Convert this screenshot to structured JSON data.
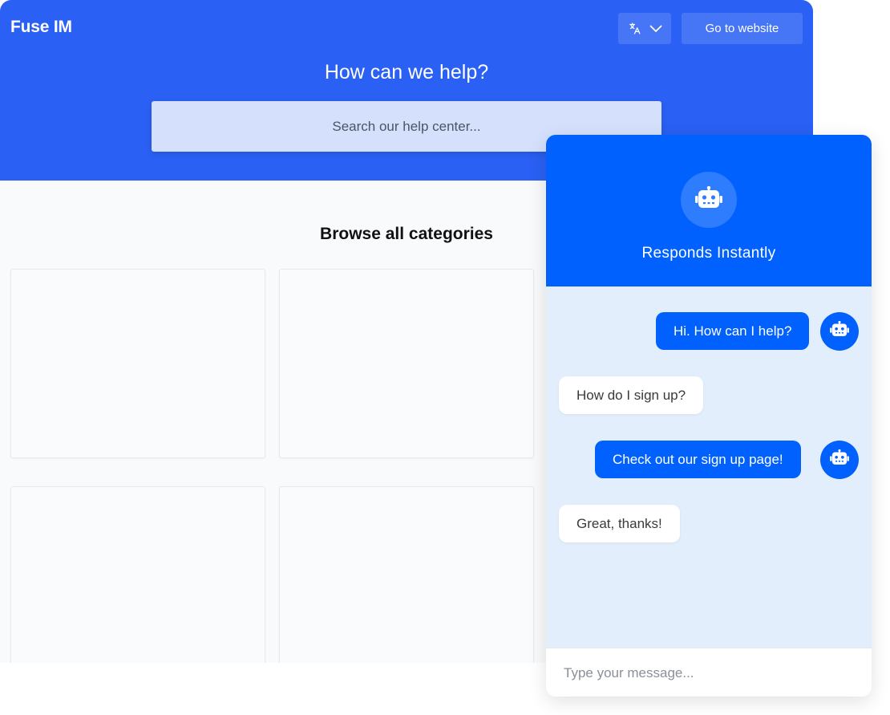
{
  "header": {
    "brand": "Fuse IM",
    "language_icon": "translate-icon",
    "dropdown_icon": "chevron-down-icon",
    "website_button": "Go to website",
    "title": "How can we help?",
    "search_placeholder": "Search our help center..."
  },
  "categories": {
    "title": "Browse all categories"
  },
  "chat": {
    "avatar_icon": "robot-icon",
    "title": "Responds Instantly",
    "messages": [
      {
        "from": "bot",
        "text": "Hi. How can I help?"
      },
      {
        "from": "user",
        "text": "How do I sign up?"
      },
      {
        "from": "bot",
        "text": "Check out our sign up page!"
      },
      {
        "from": "user",
        "text": "Great, thanks!"
      }
    ],
    "input_placeholder": "Type your message..."
  },
  "colors": {
    "hero_blue": "#2a60f4",
    "chat_blue": "#0061fe",
    "chat_background": "#e2eefb",
    "search_background": "#d5e0fd"
  }
}
